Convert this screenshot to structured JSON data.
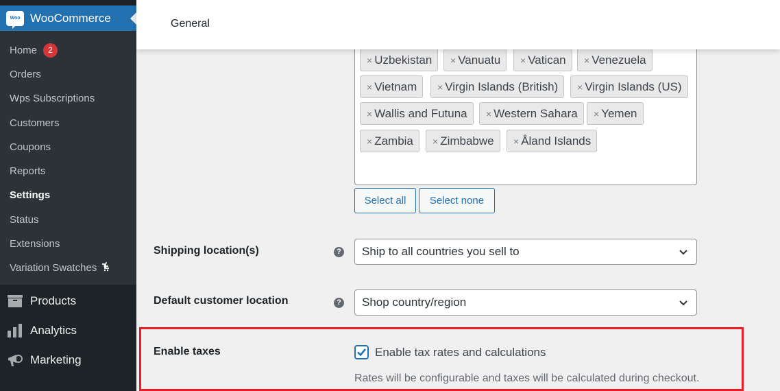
{
  "sidebar": {
    "brand": {
      "logo_text": "Woo",
      "title": "WooCommerce"
    },
    "submenu": [
      {
        "label": "Home",
        "badge": "2"
      },
      {
        "label": "Orders"
      },
      {
        "label": "Wps Subscriptions"
      },
      {
        "label": "Customers"
      },
      {
        "label": "Coupons"
      },
      {
        "label": "Reports"
      },
      {
        "label": "Settings",
        "active": true
      },
      {
        "label": "Status"
      },
      {
        "label": "Extensions"
      },
      {
        "label": "Variation Swatches",
        "icon": "swatches-cart-icon"
      }
    ],
    "main_items": [
      {
        "label": "Products",
        "icon": "archive-box-icon"
      },
      {
        "label": "Analytics",
        "icon": "bar-chart-icon"
      },
      {
        "label": "Marketing",
        "icon": "megaphone-icon"
      }
    ]
  },
  "header": {
    "title": "General"
  },
  "countries": {
    "selected": [
      "Uzbekistan",
      "Vanuatu",
      "Vatican",
      "Venezuela",
      "Vietnam",
      "Virgin Islands (British)",
      "Virgin Islands (US)",
      "Wallis and Futuna",
      "Western Sahara",
      "Yemen",
      "Zambia",
      "Zimbabwe",
      "Åland Islands"
    ],
    "remove_glyph": "×",
    "select_all": "Select all",
    "select_none": "Select none"
  },
  "shipping_location": {
    "label": "Shipping location(s)",
    "help": "?",
    "value": "Ship to all countries you sell to"
  },
  "default_customer_location": {
    "label": "Default customer location",
    "help": "?",
    "value": "Shop country/region"
  },
  "enable_taxes": {
    "label": "Enable taxes",
    "checked": true,
    "checkbox_label": "Enable tax rates and calculations",
    "description": "Rates will be configurable and taxes will be calculated during checkout."
  },
  "colors": {
    "accent": "#2271b1",
    "sidebar_bg": "#1d2327",
    "submenu_bg": "#2c3338",
    "badge": "#d63638",
    "highlight": "#ed1c24"
  }
}
